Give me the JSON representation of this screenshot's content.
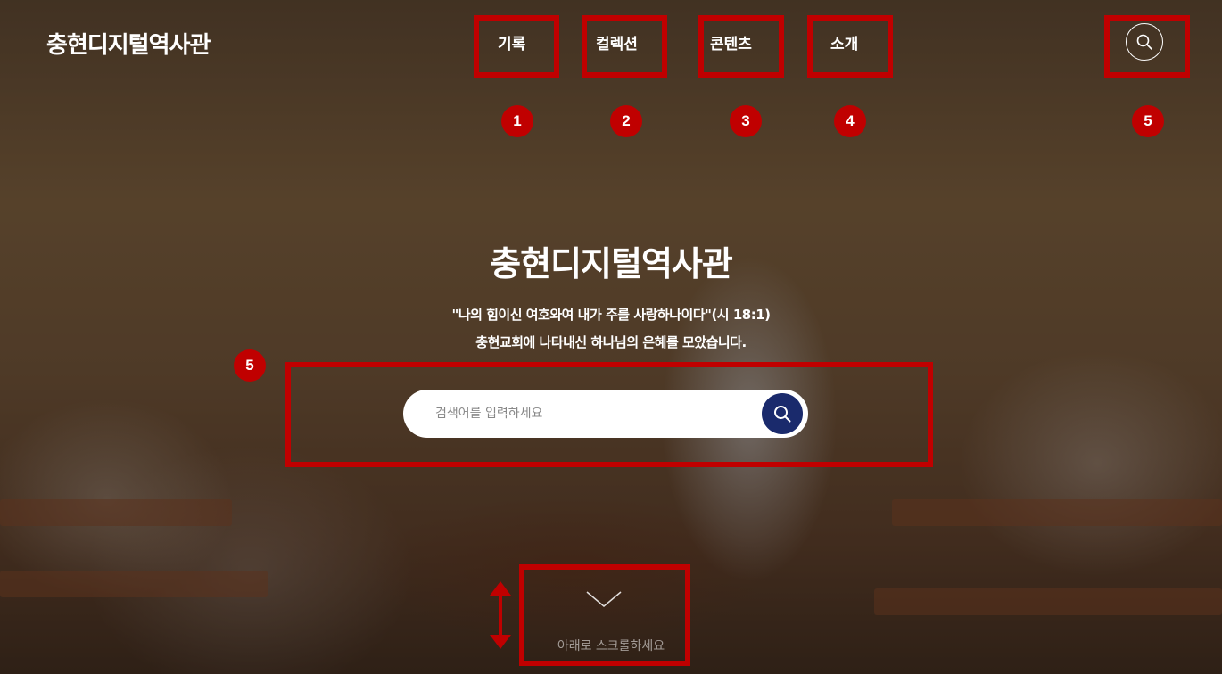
{
  "header": {
    "logo": "충현디지털역사관",
    "nav": [
      "기록",
      "컬렉션",
      "콘텐츠",
      "소개"
    ],
    "search_icon": "search-icon"
  },
  "hero": {
    "title": "충현디지털역사관",
    "verse": "\"나의 힘이신 여호와여 내가 주를 사랑하나이다\"(시 18:1)",
    "tagline": "충현교회에 나타내신 하나님의 은혜를 모았습니다.",
    "search_placeholder": "검색어를 입력하세요",
    "scroll_hint": "아래로 스크롤하세요"
  },
  "annotations": {
    "badges": [
      "1",
      "2",
      "3",
      "4",
      "5",
      "5"
    ],
    "color": "#c00000"
  },
  "colors": {
    "search_button": "#1a2a6c"
  }
}
